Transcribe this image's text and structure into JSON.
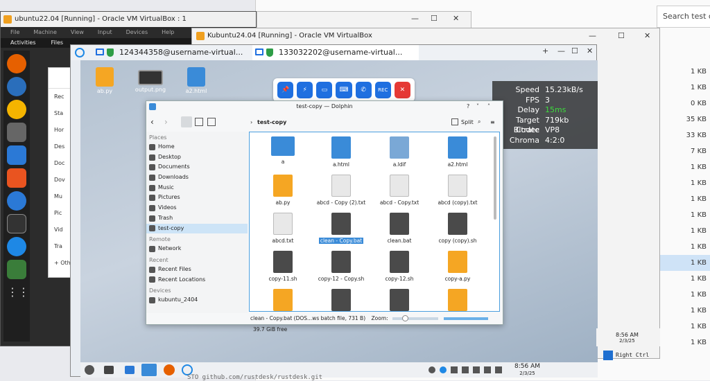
{
  "back_window": {
    "search_placeholder": "Search test co",
    "sizes": [
      "1 KB",
      "1 KB",
      "0 KB",
      "35 KB",
      "33 KB",
      "7 KB",
      "1 KB",
      "1 KB",
      "1 KB",
      "1 KB",
      "1 KB",
      "1 KB",
      "1 KB",
      "1 KB",
      "1 KB",
      "1 KB",
      "1 KB",
      "1 KB"
    ],
    "selected_size_index": 12,
    "tab_number": "2"
  },
  "vbox_ubuntu": {
    "title": "ubuntu22.04 [Running] - Oracle VM VirtualBox : 1",
    "menu": [
      "File",
      "Machine",
      "View",
      "Input",
      "Devices",
      "Help"
    ],
    "top_bar": {
      "activities": "Activities",
      "app": "Files"
    },
    "files_sidebar": [
      "Rec",
      "Sta",
      "Hor",
      "Des",
      "Doc",
      "Dov",
      "Mu",
      "Pic",
      "Vid",
      "Tra",
      "+ Oth"
    ]
  },
  "vbox_kubuntu": {
    "title": "Kubuntu24.04 [Running] - Oracle VM VirtualBox",
    "clock": {
      "time": "8:56 AM",
      "date": "2/3/25"
    },
    "host_key": "Right Ctrl"
  },
  "rustdesk": {
    "tabs": [
      "124344358@username-virtual...",
      "133032202@username-virtual..."
    ],
    "stats": [
      {
        "k": "Speed",
        "v": "15.23kB/s"
      },
      {
        "k": "FPS",
        "v": "3"
      },
      {
        "k": "Delay",
        "v": "15ms"
      },
      {
        "k": "Target Bitrate",
        "v": "719kb"
      },
      {
        "k": "Codec",
        "v": "VP8"
      },
      {
        "k": "Chroma",
        "v": "4:2:0"
      }
    ],
    "toolbar_rec": "REC",
    "desktop_icons": [
      {
        "label": "ab.py",
        "icon": "python-icon"
      },
      {
        "label": "output.png",
        "icon": "image-icon"
      },
      {
        "label": "a2.html",
        "icon": "html-icon"
      }
    ]
  },
  "dolphin": {
    "title": "test-copy — Dolphin",
    "breadcrumb": "test-copy",
    "split": "Split",
    "places_sections": {
      "places": {
        "header": "Places",
        "items": [
          "Home",
          "Desktop",
          "Documents",
          "Downloads",
          "Music",
          "Pictures",
          "Videos",
          "Trash",
          "test-copy"
        ]
      },
      "remote": {
        "header": "Remote",
        "items": [
          "Network"
        ]
      },
      "recent": {
        "header": "Recent",
        "items": [
          "Recent Files",
          "Recent Locations"
        ]
      },
      "devices": {
        "header": "Devices",
        "items": [
          "kubuntu_2404"
        ]
      }
    },
    "selected_place": "test-copy",
    "files": [
      {
        "name": "a",
        "type": "folder"
      },
      {
        "name": "a.html",
        "type": "html"
      },
      {
        "name": "a.ldif",
        "type": "ldif"
      },
      {
        "name": "a2.html",
        "type": "html"
      },
      {
        "name": "ab.py",
        "type": "python"
      },
      {
        "name": "abcd - Copy (2).txt",
        "type": "text"
      },
      {
        "name": "abcd - Copy.txt",
        "type": "text"
      },
      {
        "name": "abcd (copy).txt",
        "type": "text"
      },
      {
        "name": "abcd.txt",
        "type": "text"
      },
      {
        "name": "clean - Copy.bat",
        "type": "shell",
        "selected": true
      },
      {
        "name": "clean.bat",
        "type": "shell"
      },
      {
        "name": "copy (copy).sh",
        "type": "shell"
      },
      {
        "name": "copy-11.sh",
        "type": "shell"
      },
      {
        "name": "copy-12 - Copy.sh",
        "type": "shell"
      },
      {
        "name": "copy-12.sh",
        "type": "shell"
      },
      {
        "name": "copy-a.py",
        "type": "python"
      },
      {
        "name": "",
        "type": "python"
      },
      {
        "name": "",
        "type": "shell"
      },
      {
        "name": "",
        "type": "shell"
      },
      {
        "name": "",
        "type": "python"
      }
    ],
    "status": {
      "selection": "clean - Copy.bat (DOS...ws batch file, 731 B)",
      "zoom_label": "Zoom:",
      "free": "39.7 GiB free"
    }
  },
  "kde_panel": {
    "time": "8:56 AM",
    "date": "2/3/25"
  },
  "bottom_text": "STO github.com/rustdesk/rustdesk.git",
  "colors": {
    "accent": "#1f6fe0",
    "python": "#f5a623",
    "shell": "#4a4a4a",
    "html": "#3a8bd8",
    "selection": "#3a8bd8"
  }
}
